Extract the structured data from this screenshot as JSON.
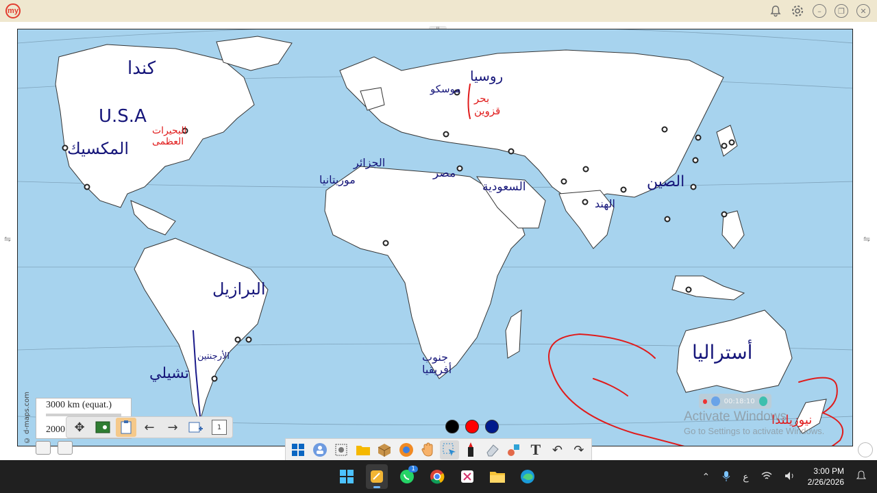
{
  "app": {
    "logo_text": "my",
    "window_controls": [
      "bell-icon",
      "gear-icon",
      "minimize-icon",
      "restore-icon",
      "close-icon"
    ]
  },
  "map": {
    "credit": "© d-maps.com",
    "scale_label": "3000 km (equat.)",
    "scale_label_2": "2000",
    "top_tab_label": "JI",
    "annotations": [
      {
        "text": "كندا",
        "color": "#16167a"
      },
      {
        "text": "U.S.A",
        "color": "#16167a"
      },
      {
        "text": "المكسيك",
        "color": "#16167a"
      },
      {
        "text": "البحيرات العظمى",
        "color": "#e01b1b"
      },
      {
        "text": "روسيا",
        "color": "#16167a"
      },
      {
        "text": "موسكو",
        "color": "#16167a"
      },
      {
        "text": "بحر قزوين",
        "color": "#e01b1b"
      },
      {
        "text": "الجزائر",
        "color": "#16167a"
      },
      {
        "text": "موريتانيا",
        "color": "#16167a"
      },
      {
        "text": "مصر",
        "color": "#16167a"
      },
      {
        "text": "السعودية",
        "color": "#16167a"
      },
      {
        "text": "الهند",
        "color": "#16167a"
      },
      {
        "text": "الصين",
        "color": "#16167a"
      },
      {
        "text": "البرازيل",
        "color": "#16167a"
      },
      {
        "text": "الأرجنتين",
        "color": "#16167a"
      },
      {
        "text": "تشيلي",
        "color": "#16167a"
      },
      {
        "text": "جنوب أفريقيا",
        "color": "#16167a"
      },
      {
        "text": "أستراليا",
        "color": "#16167a"
      },
      {
        "text": "نيوزيلندا",
        "color": "#e01b1b"
      }
    ]
  },
  "mini_toolbar": {
    "page_number": "1",
    "tools": [
      "move-icon",
      "whiteboard-icon",
      "clipboard-icon",
      "back-arrow-icon",
      "forward-arrow-icon",
      "add-page-icon"
    ]
  },
  "pen_colors": [
    "#000000",
    "#ff0000",
    "#001a8c"
  ],
  "anno_toolbar": {
    "tools": [
      "windows-icon",
      "users-icon",
      "camera-icon",
      "folder-icon",
      "box-icon",
      "browser-icon",
      "hand-icon",
      "select-icon",
      "marker-icon",
      "eraser-icon",
      "shapes-icon",
      "text-icon",
      "undo-icon",
      "redo-icon"
    ]
  },
  "recorder": {
    "time": "00:18:10"
  },
  "watermark": {
    "line1": "Activate Windows",
    "line2": "Go to Settings to activate Windows."
  },
  "taskbar": {
    "apps": [
      "start-icon",
      "notes-icon",
      "whatsapp-icon",
      "chrome-icon",
      "snip-icon",
      "file-explorer-icon",
      "edge-icon"
    ],
    "whatsapp_badge": "1",
    "lang": "ع",
    "time": "3:00 PM",
    "date": "2/26/2026"
  }
}
